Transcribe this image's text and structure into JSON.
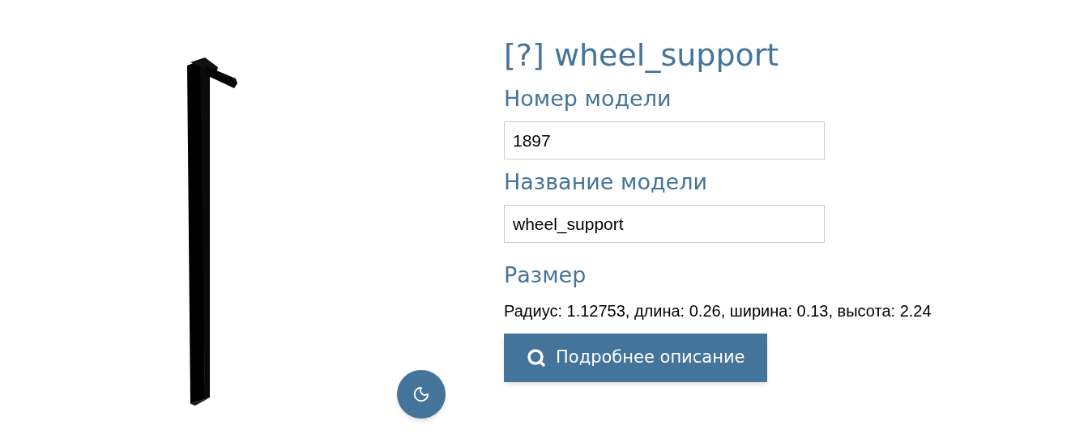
{
  "title": "[?] wheel_support",
  "fields": [
    {
      "label": "Номер модели",
      "value": "1897"
    },
    {
      "label": "Название модели",
      "value": "wheel_support"
    }
  ],
  "size": {
    "label": "Размер",
    "text": "Радиус: 1.12753, длина: 0.26, ширина: 0.13, высота: 2.24"
  },
  "details_button": "Подробнее описание"
}
